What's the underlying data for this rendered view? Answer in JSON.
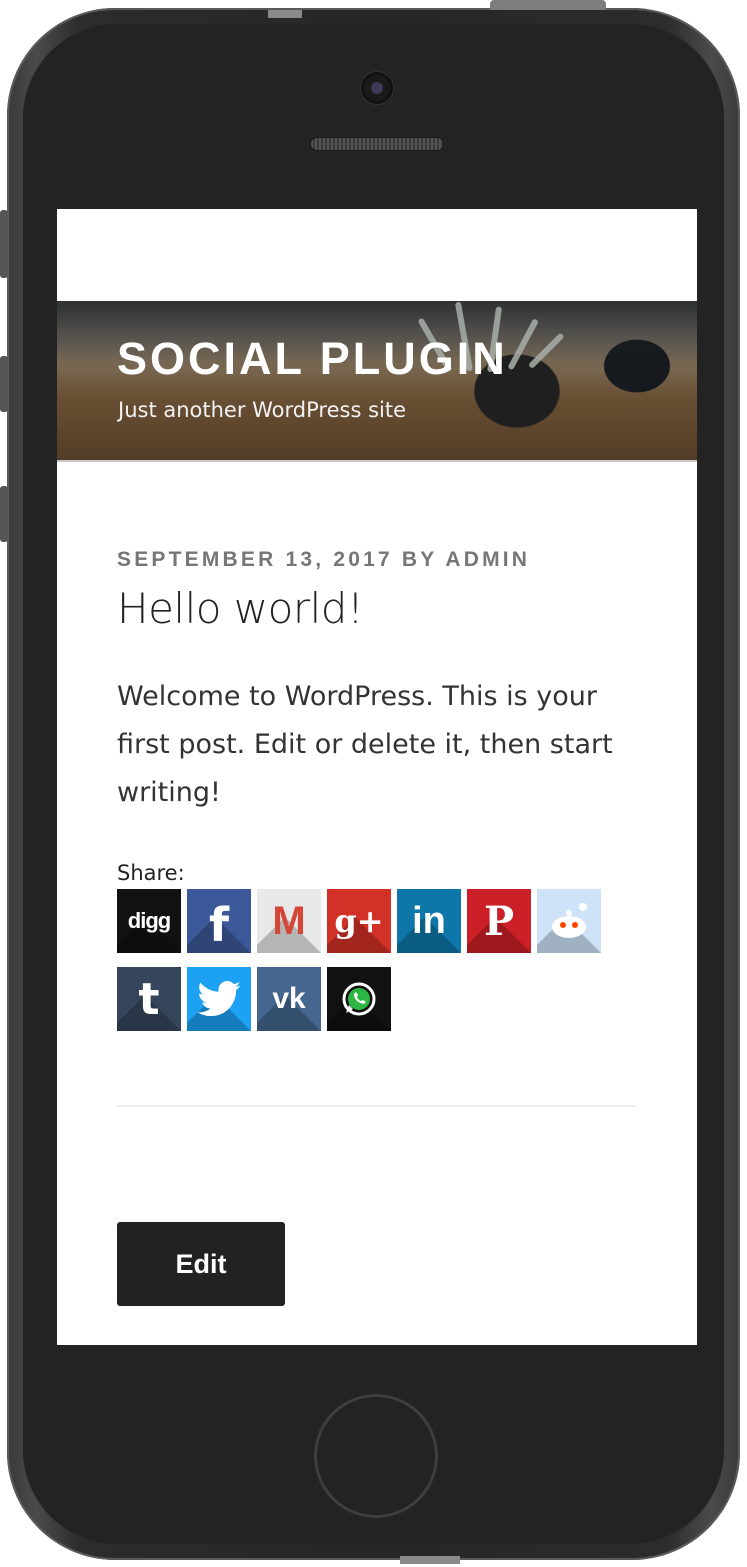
{
  "site": {
    "title": "SOCIAL PLUGIN",
    "tagline": "Just another WordPress site"
  },
  "post": {
    "meta": "SEPTEMBER 13, 2017 BY ADMIN",
    "title": "Hello world!",
    "body": "Welcome to WordPress. This is your first post. Edit or delete it, then start writing!"
  },
  "share": {
    "label": "Share:",
    "icons": [
      {
        "name": "digg-icon",
        "text": "digg",
        "color": "#111111"
      },
      {
        "name": "facebook-icon",
        "text": "f",
        "color": "#3b5998"
      },
      {
        "name": "gmail-icon",
        "text": "M",
        "color": "#e8e8e8"
      },
      {
        "name": "google-plus-icon",
        "text": "g+",
        "color": "#d13127"
      },
      {
        "name": "linkedin-icon",
        "text": "in",
        "color": "#0e76a8"
      },
      {
        "name": "pinterest-icon",
        "text": "P",
        "color": "#cb2027"
      },
      {
        "name": "reddit-icon",
        "text": "",
        "color": "#cee3f8"
      },
      {
        "name": "tumblr-icon",
        "text": "t",
        "color": "#35465c"
      },
      {
        "name": "twitter-icon",
        "text": "",
        "color": "#1da1f2"
      },
      {
        "name": "vk-icon",
        "text": "vk",
        "color": "#45668e"
      },
      {
        "name": "whatsapp-icon",
        "text": "",
        "color": "#111111"
      }
    ]
  },
  "actions": {
    "edit_label": "Edit"
  }
}
